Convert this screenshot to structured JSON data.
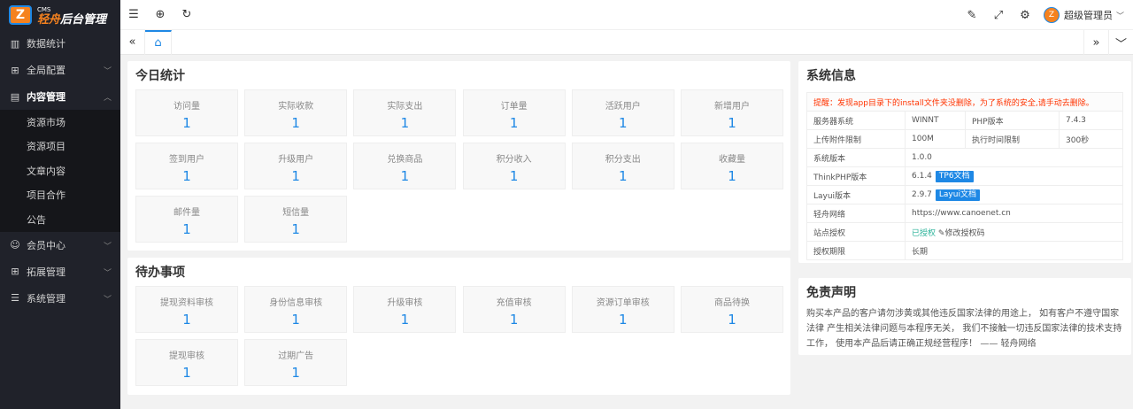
{
  "logo": {
    "badge": "Z",
    "small": "CMS",
    "brand": "轻舟",
    "title": "后台管理"
  },
  "sidebar": {
    "items": [
      {
        "label": "数据统计",
        "icon": "bar-chart-icon"
      },
      {
        "label": "全局配置",
        "icon": "grid-icon"
      },
      {
        "label": "内容管理",
        "icon": "document-icon"
      },
      {
        "label": "会员中心",
        "icon": "users-icon"
      },
      {
        "label": "拓展管理",
        "icon": "apps-icon"
      },
      {
        "label": "系统管理",
        "icon": "list-icon"
      }
    ],
    "sub": [
      "资源市场",
      "资源项目",
      "文章内容",
      "项目合作",
      "公告"
    ]
  },
  "header": {
    "username": "超级管理员"
  },
  "today": {
    "title": "今日统计",
    "stats": [
      {
        "label": "访问量",
        "value": "1"
      },
      {
        "label": "实际收款",
        "value": "1"
      },
      {
        "label": "实际支出",
        "value": "1"
      },
      {
        "label": "订单量",
        "value": "1"
      },
      {
        "label": "活跃用户",
        "value": "1"
      },
      {
        "label": "新增用户",
        "value": "1"
      },
      {
        "label": "签到用户",
        "value": "1"
      },
      {
        "label": "升级用户",
        "value": "1"
      },
      {
        "label": "兑换商品",
        "value": "1"
      },
      {
        "label": "积分收入",
        "value": "1"
      },
      {
        "label": "积分支出",
        "value": "1"
      },
      {
        "label": "收藏量",
        "value": "1"
      },
      {
        "label": "邮件量",
        "value": "1"
      },
      {
        "label": "短信量",
        "value": "1"
      }
    ]
  },
  "todo": {
    "title": "待办事项",
    "stats": [
      {
        "label": "提现资料审核",
        "value": "1"
      },
      {
        "label": "身份信息审核",
        "value": "1"
      },
      {
        "label": "升级审核",
        "value": "1"
      },
      {
        "label": "充值审核",
        "value": "1"
      },
      {
        "label": "资源订单审核",
        "value": "1"
      },
      {
        "label": "商品待换",
        "value": "1"
      },
      {
        "label": "提现审核",
        "value": "1"
      },
      {
        "label": "过期广告",
        "value": "1"
      }
    ]
  },
  "sysinfo": {
    "title": "系统信息",
    "warning": "提醒：发现app目录下的install文件夹没删除，为了系统的安全,请手动去删除。",
    "server_label": "服务器系统",
    "server": "WINNT",
    "php_label": "PHP版本",
    "php": "7.4.3",
    "upload_label": "上传附件限制",
    "upload": "100M",
    "exec_label": "执行时间限制",
    "exec": "300秒",
    "sysver_label": "系统版本",
    "sysver": "1.0.0",
    "tp_label": "ThinkPHP版本",
    "tp": "6.1.4",
    "tp_doc": "TP6文档",
    "layui_label": "Layui版本",
    "layui": "2.9.7",
    "layui_doc": "Layui文档",
    "site_label": "轻舟网络",
    "site": "https://www.canoenet.cn",
    "auth_label": "站点授权",
    "auth": "已授权",
    "auth_edit": "修改授权码",
    "term_label": "授权期限",
    "term": "长期"
  },
  "disclaimer": {
    "title": "免责声明",
    "text": "购买本产品的客户请勿涉黄或其他违反国家法律的用途上， 如有客户不遵守国家法律 产生相关法律问题与本程序无关， 我们不接触一切违反国家法律的技术支持工作， 使用本产品后请正确正规经营程序！ —— 轻舟网络"
  }
}
